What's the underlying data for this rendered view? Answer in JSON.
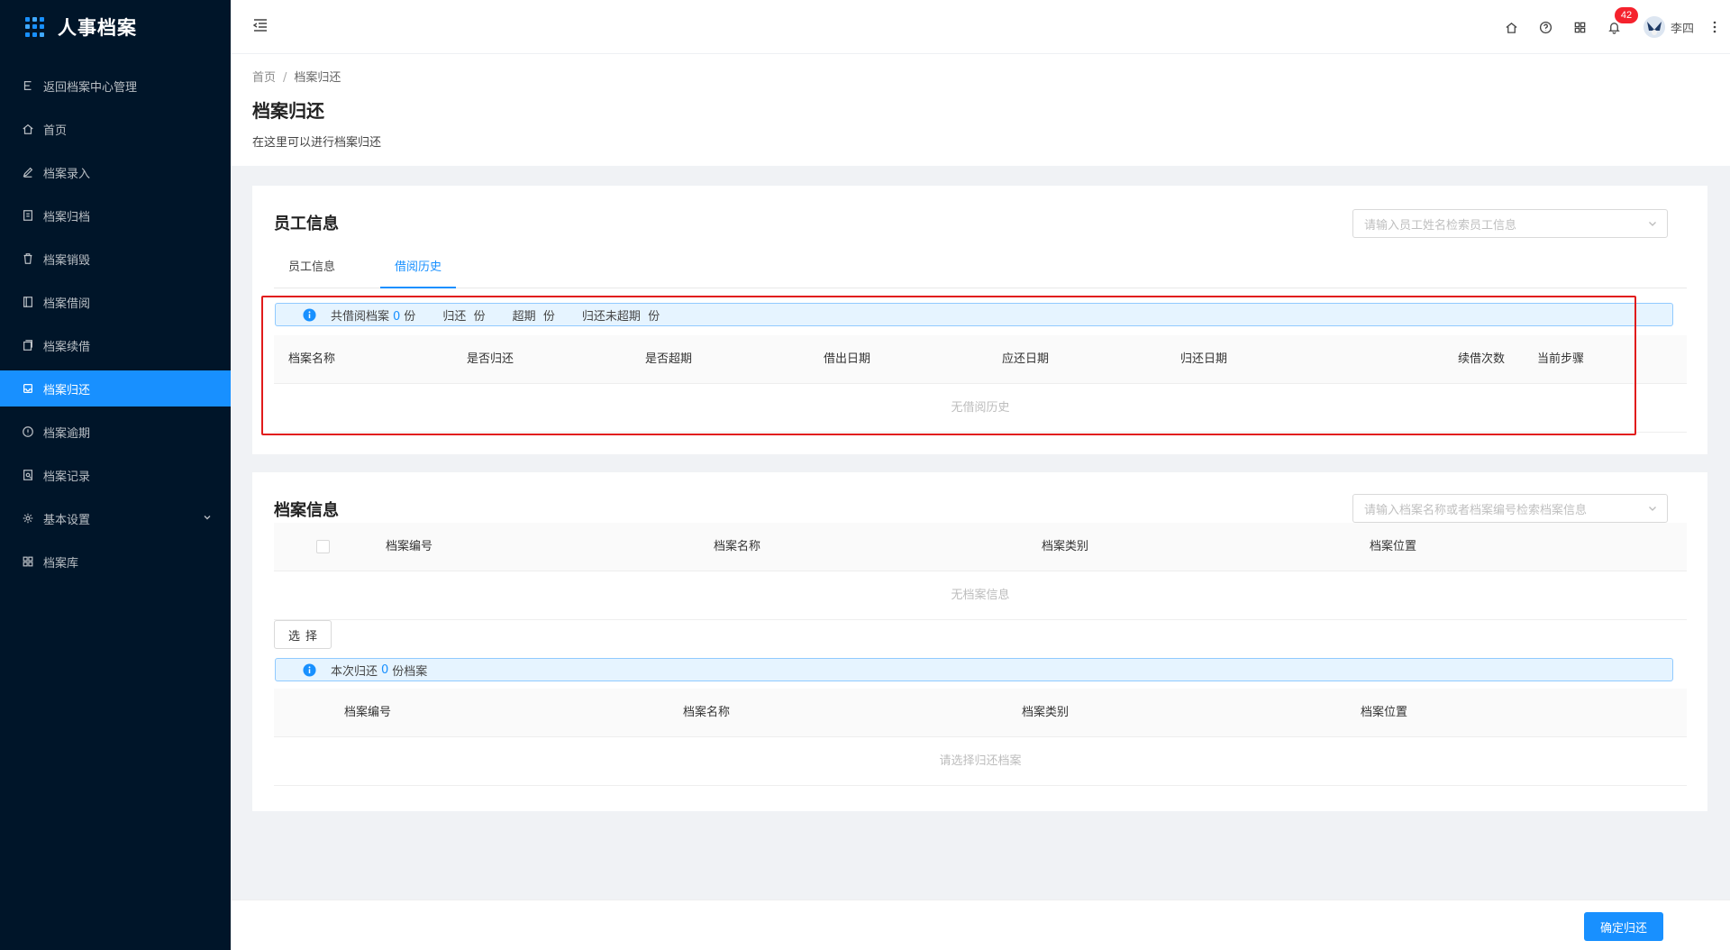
{
  "app": {
    "title": "人事档案"
  },
  "sidebar": {
    "items": [
      {
        "label": "返回档案中心管理",
        "icon": "return-icon"
      },
      {
        "label": "首页",
        "icon": "home-icon"
      },
      {
        "label": "档案录入",
        "icon": "edit-icon"
      },
      {
        "label": "档案归档",
        "icon": "archive-icon"
      },
      {
        "label": "档案销毁",
        "icon": "trash-icon"
      },
      {
        "label": "档案借阅",
        "icon": "book-icon"
      },
      {
        "label": "档案续借",
        "icon": "copy-icon"
      },
      {
        "label": "档案归还",
        "icon": "inbox-icon",
        "active": true
      },
      {
        "label": "档案逾期",
        "icon": "alert-icon"
      },
      {
        "label": "档案记录",
        "icon": "record-icon"
      },
      {
        "label": "基本设置",
        "icon": "gear-icon",
        "expandable": true
      },
      {
        "label": "档案库",
        "icon": "grid-icon"
      }
    ]
  },
  "header": {
    "notification_count": "42",
    "user_name": "李四"
  },
  "page": {
    "breadcrumb": [
      "首页",
      "档案归还"
    ],
    "title": "档案归还",
    "description": "在这里可以进行档案归还"
  },
  "employee_card": {
    "title": "员工信息",
    "search_placeholder": "请输入员工姓名检索员工信息",
    "tabs": [
      {
        "label": "员工信息",
        "active": false
      },
      {
        "label": "借阅历史",
        "active": true
      }
    ],
    "summary": {
      "total_label": "共借阅档案",
      "total_value": "0",
      "unit": "份",
      "returned_label": "归还",
      "overdue_label": "超期",
      "not_returned_label": "归还未超期"
    },
    "columns": [
      "档案名称",
      "是否归还",
      "是否超期",
      "借出日期",
      "应还日期",
      "归还日期",
      "续借次数",
      "当前步骤"
    ],
    "empty_text": "无借阅历史"
  },
  "archive_card": {
    "title": "档案信息",
    "search_placeholder": "请输入档案名称或者档案编号检索档案信息",
    "columns": [
      "档案编号",
      "档案名称",
      "档案类别",
      "档案位置"
    ],
    "empty_text": "无档案信息",
    "select_button": "选择",
    "return_summary": {
      "prefix": "本次归还",
      "value": "0",
      "suffix": "份档案"
    },
    "return_columns": [
      "档案编号",
      "档案名称",
      "档案类别",
      "档案位置"
    ],
    "return_empty_text": "请选择归还档案"
  },
  "footer": {
    "confirm_label": "确定归还"
  },
  "colors": {
    "primary": "#1890ff",
    "sidebar_bg": "#001529",
    "highlight": "#e11b1b"
  }
}
